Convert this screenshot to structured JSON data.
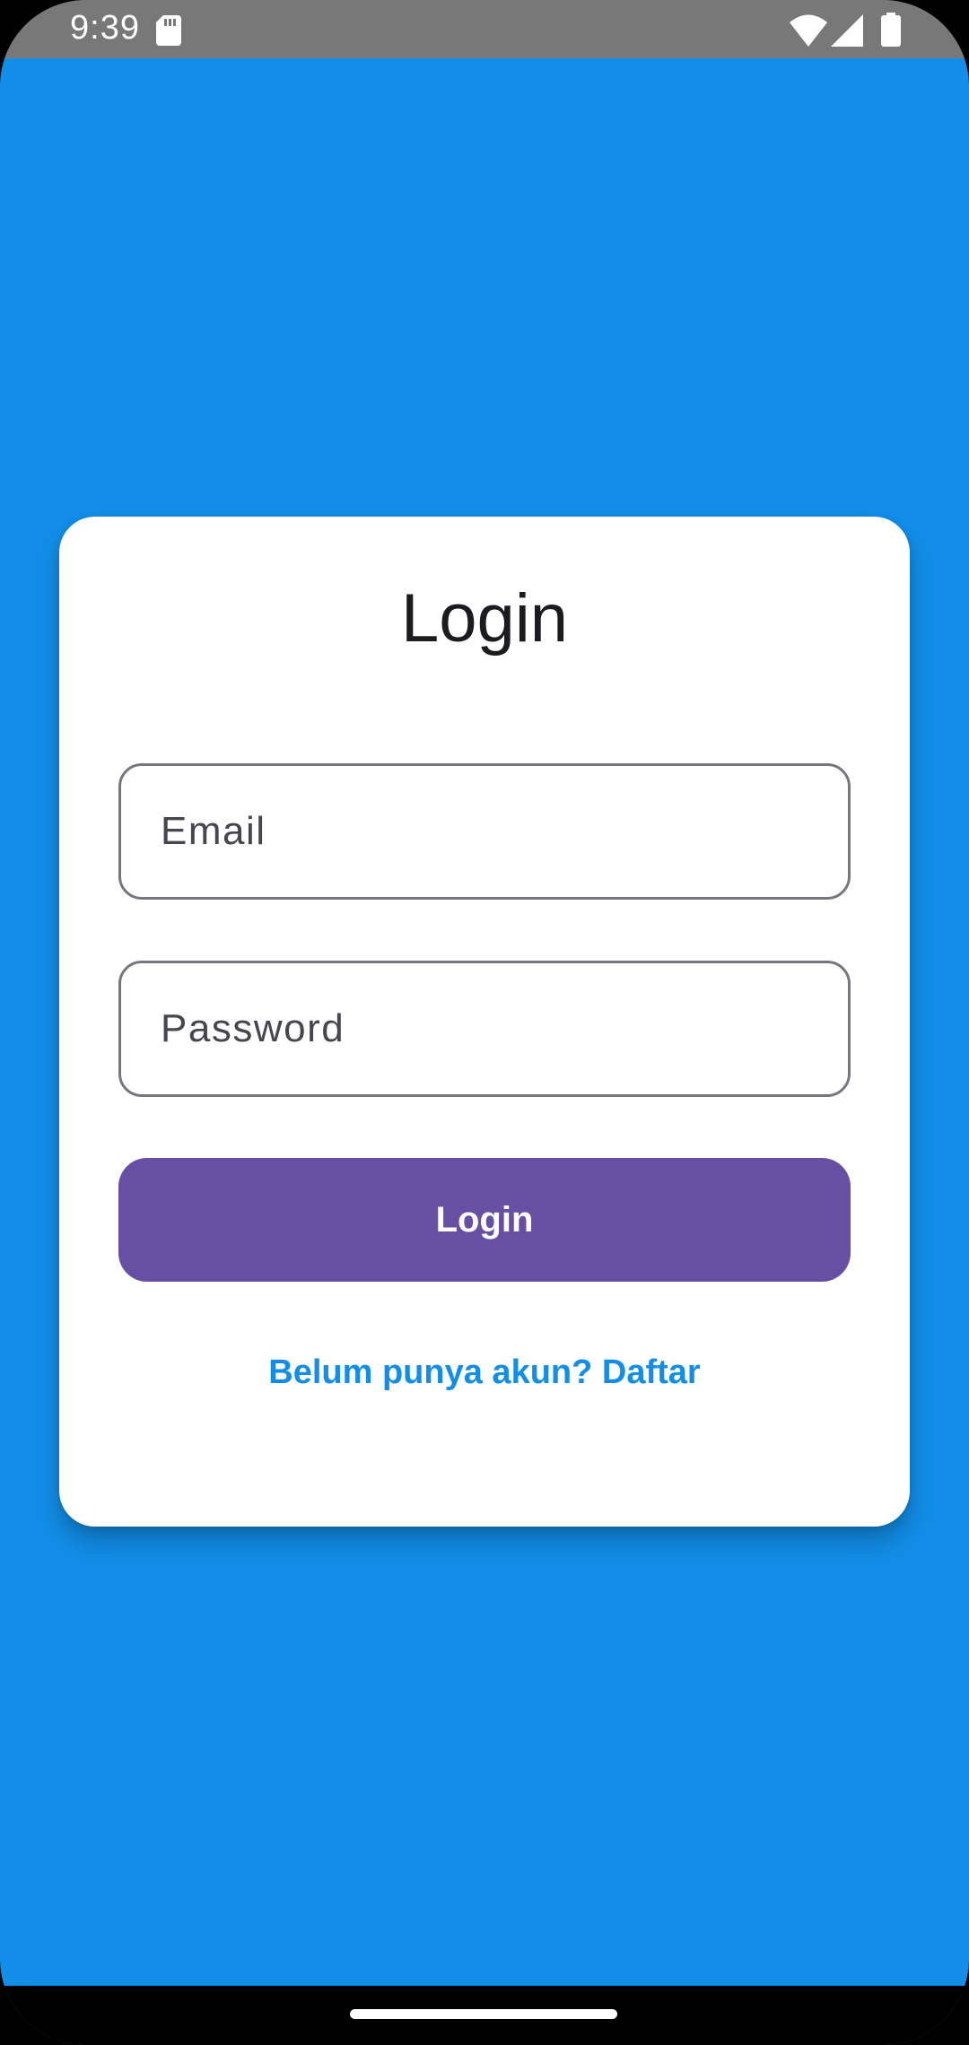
{
  "status_bar": {
    "time": "9:39",
    "icons": [
      "sd-card-icon",
      "wifi-icon",
      "signal-icon",
      "battery-icon"
    ]
  },
  "login_card": {
    "title": "Login",
    "email_placeholder": "Email",
    "email_value": "",
    "password_placeholder": "Password",
    "password_value": "",
    "login_button_label": "Login",
    "register_link": "Belum punya akun? Daftar"
  },
  "colors": {
    "background": "#128EE9",
    "card": "#FFFFFF",
    "button": "#6750A4",
    "link": "#128EE9",
    "field_border": "#79747E",
    "status_bar": "#787878"
  }
}
